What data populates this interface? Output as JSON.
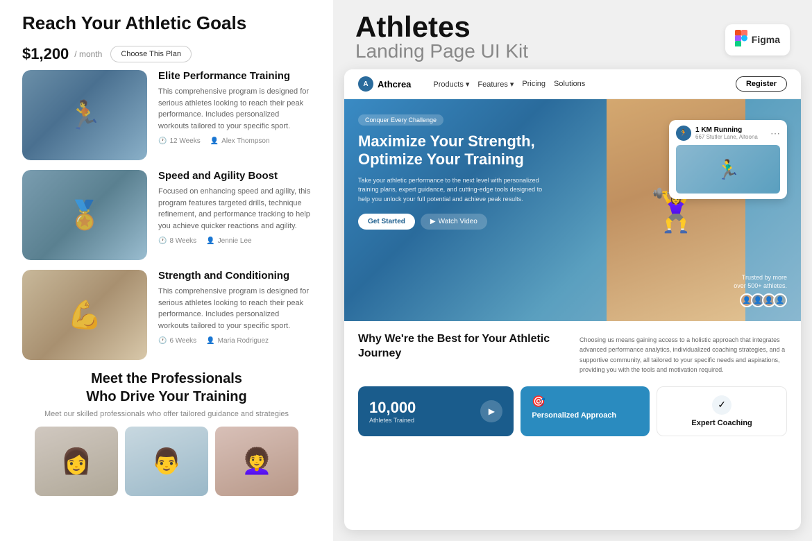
{
  "left": {
    "header": "Reach Your Athletic Goals",
    "pricing": {
      "amount": "$1,200",
      "period": "/ month",
      "choose_label": "Choose This Plan"
    },
    "programs": [
      {
        "title": "Elite Performance Training",
        "description": "This comprehensive program is designed for serious athletes looking to reach their peak performance. Includes personalized workouts tailored to your specific sport.",
        "duration": "12 Weeks",
        "coach": "Alex Thompson",
        "img_type": "runner"
      },
      {
        "title": "Speed and Agility Boost",
        "description": "Focused on enhancing speed and agility, this program features targeted drills, technique refinement, and performance tracking to help you achieve quicker reactions and agility.",
        "duration": "8 Weeks",
        "coach": "Jennie Lee",
        "img_type": "bridge"
      },
      {
        "title": "Strength and Conditioning",
        "description": "This comprehensive program is designed for serious athletes looking to reach their peak performance. Includes personalized workouts tailored to your specific sport.",
        "duration": "6 Weeks",
        "coach": "Maria Rodriguez",
        "img_type": "strength"
      }
    ],
    "professionals": {
      "title": "Meet the Professionals\nWho Drive Your Training",
      "subtitle": "Meet our skilled professionals who offer tailored guidance and strategies",
      "cards": [
        {
          "img_type": "prof1"
        },
        {
          "img_type": "prof2"
        },
        {
          "img_type": "prof3"
        }
      ]
    }
  },
  "right": {
    "kit_title": "Athletes",
    "kit_subtitle": "Landing Page UI Kit",
    "figma_label": "Figma",
    "landing": {
      "nav": {
        "logo": "Athcrea",
        "links": [
          "Products",
          "Features",
          "Pricing",
          "Solutions"
        ],
        "register_label": "Register"
      },
      "hero": {
        "badge": "Conquer Every Challenge",
        "title": "Maximize Your Strength, Optimize Your Training",
        "description": "Take your athletic performance to the next level with personalized training plans, expert guidance, and cutting-edge tools designed to help you unlock your full potential and achieve peak results.",
        "cta_primary": "Get Started",
        "cta_secondary": "Watch Video",
        "running_card": {
          "title": "1 KM Running",
          "subtitle": "667 Stutler Lane, Altoona"
        },
        "trusted_title": "Trusted by more\nover 500+ athletes."
      },
      "why": {
        "title": "Why We're the Best for Your Athletic Journey",
        "description": "Choosing us means gaining access to a holistic approach that integrates advanced performance analytics, individualized coaching strategies, and a supportive community, all tailored to your specific needs and aspirations, providing you with the tools and motivation required."
      },
      "stats": [
        {
          "number": "10,000",
          "label": "Athletes Trained",
          "type": "dark"
        },
        {
          "icon": "🎯",
          "title": "Personalized Approach",
          "type": "blue"
        },
        {
          "icon": "✓",
          "title": "Expert Coaching",
          "type": "white"
        }
      ]
    }
  }
}
